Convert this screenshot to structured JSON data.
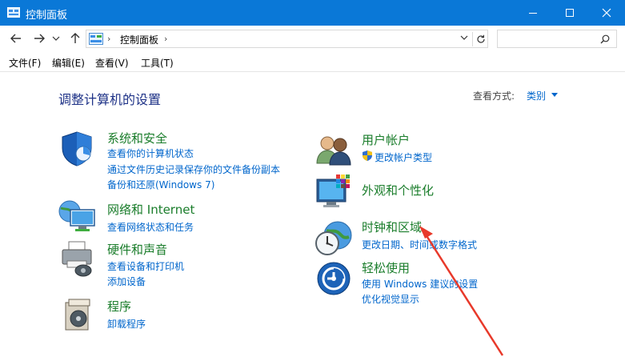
{
  "window": {
    "title": "控制面板",
    "minimize_icon": "minimize-icon",
    "maximize_icon": "maximize-icon",
    "close_icon": "close-icon"
  },
  "nav": {
    "back_icon": "arrow-left-icon",
    "forward_icon": "arrow-right-icon",
    "recent_icon": "chevron-down-icon",
    "up_icon": "arrow-up-icon"
  },
  "address": {
    "crumb": "控制面板",
    "separator_1": "›",
    "separator_2": "›"
  },
  "search": {
    "placeholder": "",
    "icon": "search-icon"
  },
  "menu": [
    {
      "label": "文件(F)"
    },
    {
      "label": "编辑(E)"
    },
    {
      "label": "查看(V)"
    },
    {
      "label": "工具(T)"
    }
  ],
  "page": {
    "heading": "调整计算机的设置",
    "view_by_label": "查看方式:",
    "view_by_value": "类别"
  },
  "categories": {
    "system": {
      "title": "系统和安全",
      "links": [
        "查看你的计算机状态",
        "通过文件历史记录保存你的文件备份副本",
        "备份和还原(Windows 7)"
      ]
    },
    "network": {
      "title": "网络和 Internet",
      "links": [
        "查看网络状态和任务"
      ]
    },
    "hardware": {
      "title": "硬件和声音",
      "links": [
        "查看设备和打印机",
        "添加设备"
      ]
    },
    "programs": {
      "title": "程序",
      "links": [
        "卸载程序"
      ]
    },
    "users": {
      "title": "用户帐户",
      "links": [
        "更改帐户类型"
      ]
    },
    "appearance": {
      "title": "外观和个性化",
      "links": []
    },
    "clock": {
      "title": "时钟和区域",
      "links": [
        "更改日期、时间或数字格式"
      ]
    },
    "ease": {
      "title": "轻松使用",
      "links": [
        "使用 Windows 建议的设置",
        "优化视觉显示"
      ]
    }
  },
  "colors": {
    "titlebar": "#0a78d7",
    "category_title": "#1a7d2b",
    "link": "#0066cc",
    "heading": "#1e3287",
    "annotation_arrow": "#e8392a"
  }
}
